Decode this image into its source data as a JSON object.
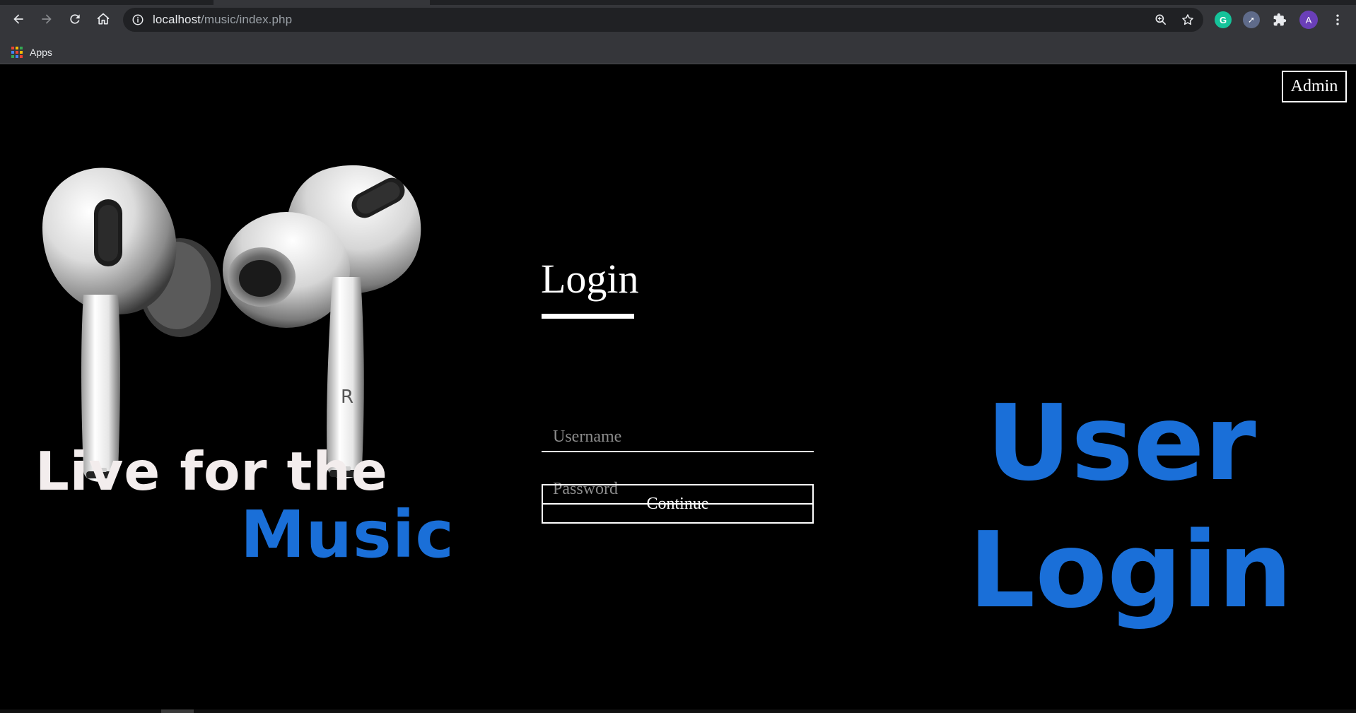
{
  "browser": {
    "url_host": "localhost",
    "url_path": "/music/index.php",
    "bookmarks": [
      {
        "label": "Apps",
        "icon": "apps-grid-icon"
      }
    ],
    "extensions": [
      {
        "name": "grammarly-icon",
        "glyph": "G",
        "color": "#15c39a"
      },
      {
        "name": "cursor-extension-icon",
        "glyph": "➚",
        "color": "#5f6b8a"
      },
      {
        "name": "extensions-puzzle-icon"
      }
    ],
    "profile_initial": "A",
    "profile_color": "#6a3fb8"
  },
  "page": {
    "admin_label": "Admin",
    "tagline_line1": "Live for the",
    "tagline_line2": "Music",
    "login": {
      "title": "Login",
      "username_placeholder": "Username",
      "password_placeholder": "Password",
      "continue_label": "Continue"
    },
    "big_heading_line1": "User",
    "big_heading_line2": "Login",
    "earbud_letter": "R"
  },
  "colors": {
    "accent_blue": "#1a6fd8",
    "background": "#000000",
    "text_white": "#ffffff"
  }
}
